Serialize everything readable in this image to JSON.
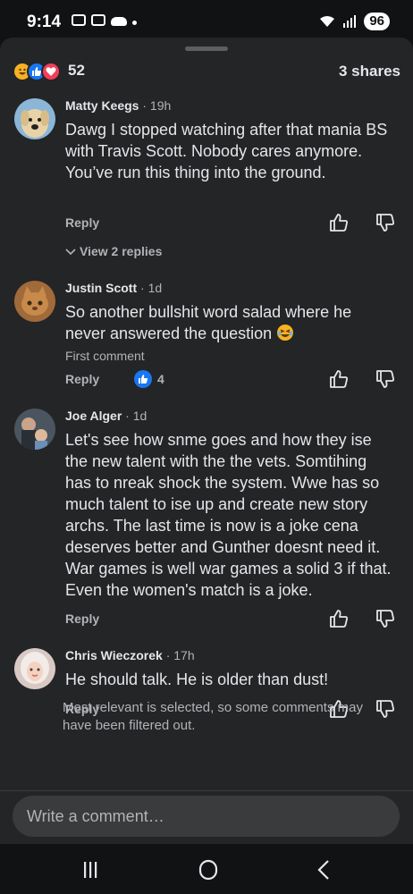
{
  "status": {
    "time": "9:14",
    "battery": "96"
  },
  "summary": {
    "reaction_count": "52",
    "shares": "3 shares",
    "reactions": [
      "haha",
      "like",
      "love"
    ]
  },
  "comments": [
    {
      "name": "Matty Keegs",
      "time": "19h",
      "text": "Dawg I stopped watching after that mania BS with Travis Scott. Nobody cares anymore. You’ve run this thing into the ground.",
      "reply_label": "Reply",
      "view_replies": "View 2 replies"
    },
    {
      "name": "Justin Scott",
      "time": "1d",
      "text": "So another bullshit word salad where he never answered the question",
      "first_comment": "First comment",
      "reply_label": "Reply",
      "likes": "4"
    },
    {
      "name": "Joe Alger",
      "time": "1d",
      "text": "Let's see how snme goes and how they ise the new talent with the the vets. Somtihing has to nreak shock the system. Wwe has so much talent to ise up and create new story archs. The last time is now is a joke cena deserves better and Gunther doesnt need it. War games is well war games a solid 3 if that. Even the women's match is a joke.",
      "reply_label": "Reply"
    },
    {
      "name": "Chris Wieczorek",
      "time": "17h",
      "text": "He should talk. He is older than dust!",
      "reply_label": "Reply"
    }
  ],
  "footnote": "Most relevant is selected, so some comments may have been filtered out.",
  "composer": {
    "placeholder": "Write a comment…"
  },
  "colors": {
    "sheet": "#242526",
    "text": "#e4e6eb",
    "muted": "#b0b3b8",
    "like_blue": "#1877f2"
  }
}
